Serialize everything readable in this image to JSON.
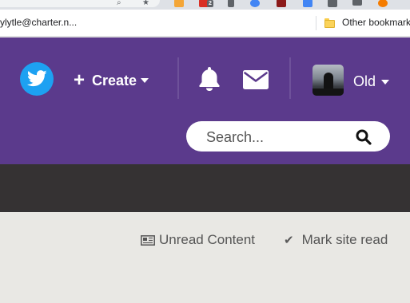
{
  "browser": {
    "ext_badge_count": "2",
    "bookmark_left_text": "ylytle@charter.n...",
    "bookmark_other_label": "Other bookmark"
  },
  "header": {
    "create_label": "Create",
    "user_name": "Old",
    "search_placeholder": "Search..."
  },
  "content": {
    "unread_label": "Unread Content",
    "mark_read_label": "Mark site read"
  },
  "colors": {
    "header_bg": "#5b3a8c",
    "twitter_blue": "#1da1f2",
    "dark_bar": "#353233",
    "content_bg": "#e9e8e4"
  },
  "icons": [
    "twitter-icon",
    "plus-icon",
    "bell-icon",
    "mail-icon",
    "search-icon",
    "newspaper-icon",
    "check-icon",
    "folder-icon"
  ]
}
